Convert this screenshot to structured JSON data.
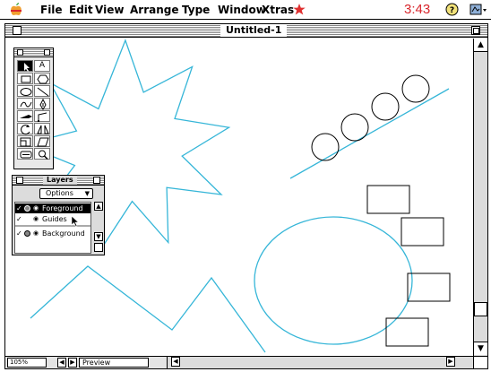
{
  "menubar": {
    "items": [
      "File",
      "Edit",
      "View",
      "Arrange",
      "Type",
      "Window",
      "Xtras"
    ],
    "clock": "3:43",
    "icons": [
      "apple-menu-icon",
      "xtras-star-icon",
      "help-icon",
      "application-icon"
    ]
  },
  "window": {
    "title": "Untitled-1"
  },
  "statusbar": {
    "zoom": "105%",
    "view_mode": "Preview"
  },
  "toolbox": {
    "tools": [
      "pointer",
      "text",
      "rectangle",
      "polygon",
      "ellipse",
      "line",
      "freehand",
      "pen",
      "knife",
      "bezigon",
      "rotate",
      "reflect",
      "scale",
      "skew",
      "trace",
      "zoom"
    ],
    "text_tool_label": "A"
  },
  "layers": {
    "title": "Layers",
    "options_label": "Options",
    "rows": [
      {
        "name": "Foreground",
        "selected": true
      },
      {
        "name": "Guides",
        "selected": false
      },
      {
        "name": "Background",
        "selected": false
      }
    ]
  },
  "colors": {
    "stroke": "#36b6d8",
    "clock": "#d8272d",
    "star": "#e03030"
  }
}
